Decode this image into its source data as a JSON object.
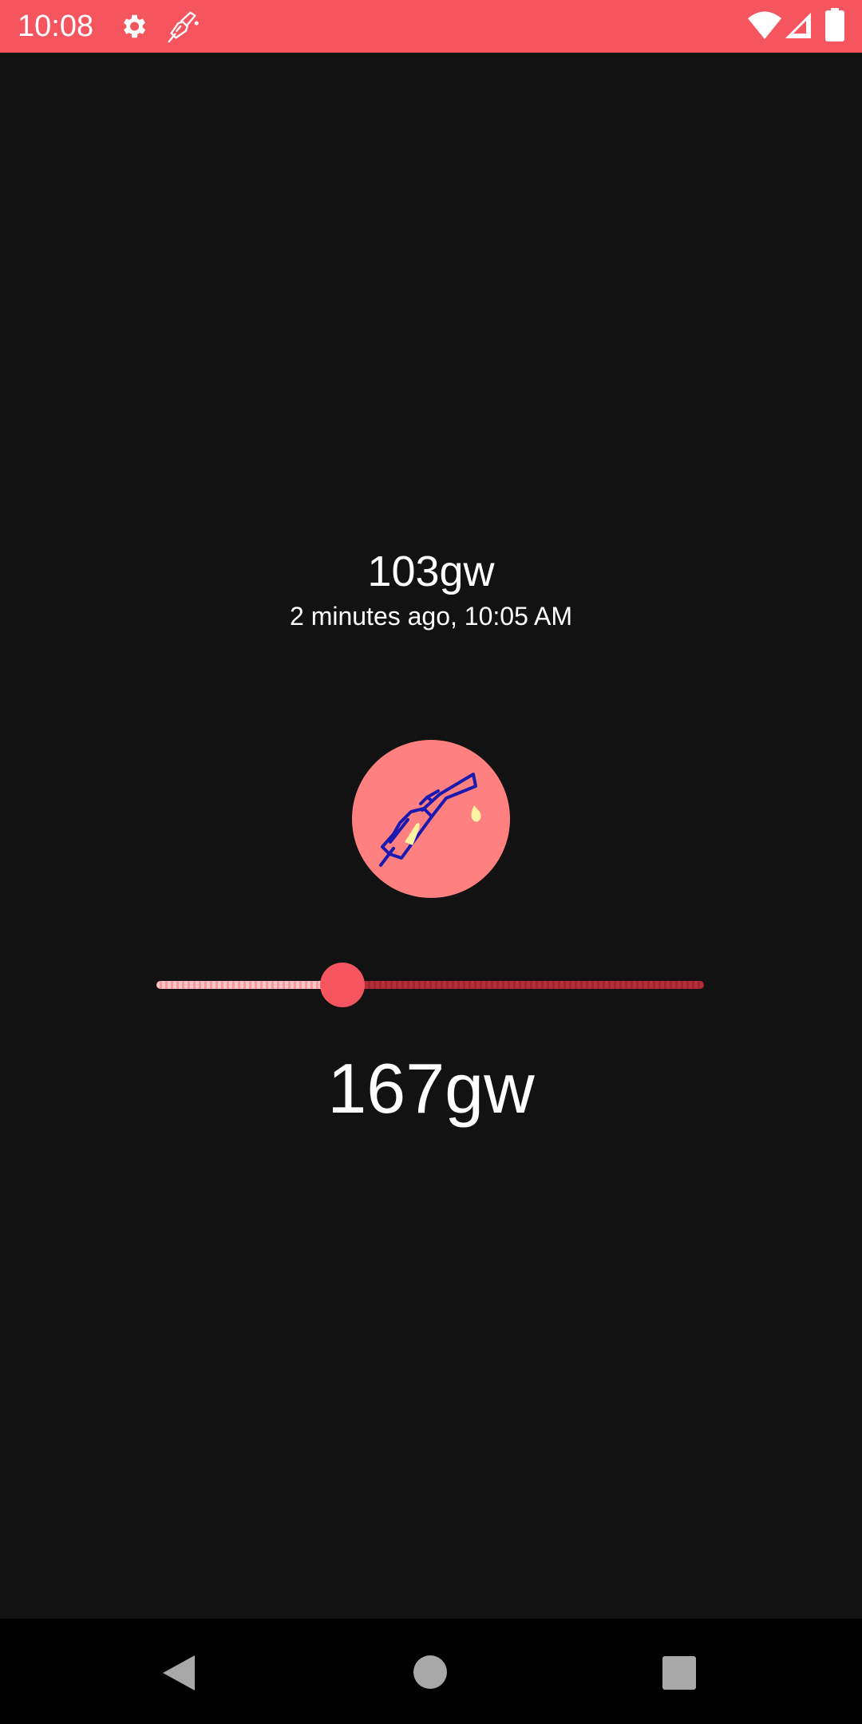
{
  "status_bar": {
    "time": "10:08",
    "background_color": "#f4555f",
    "icons": [
      "gear-icon",
      "fuel-pump-icon",
      "wifi-icon",
      "signal-icon",
      "battery-icon"
    ]
  },
  "main": {
    "last_reading": "103gw",
    "last_reading_time": "2 minutes ago, 10:05 AM",
    "fuel_button_icon": "fuel-nozzle-icon",
    "slider": {
      "value_fraction": 0.34,
      "accent_color": "#f4555f"
    },
    "current_value": "167gw"
  },
  "nav_bar": {
    "icons": [
      "back-icon",
      "home-icon",
      "recents-icon"
    ]
  }
}
